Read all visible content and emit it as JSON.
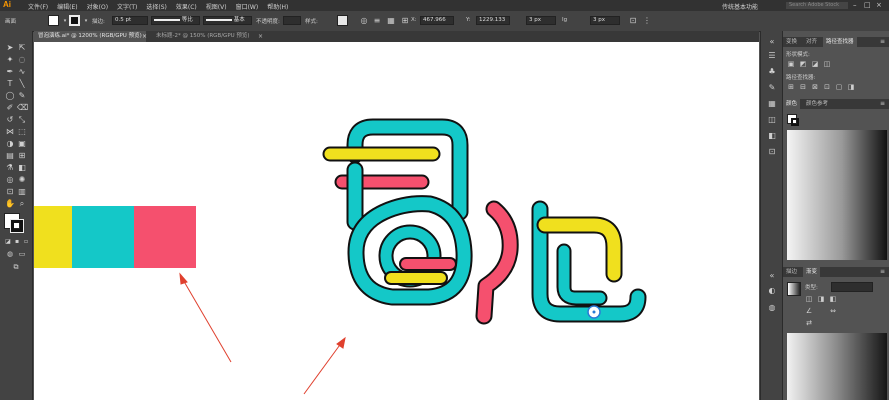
{
  "app": {
    "logo": "Ai"
  },
  "menu": [
    "文件(F)",
    "编辑(E)",
    "对象(O)",
    "文字(T)",
    "选择(S)",
    "效果(C)",
    "视图(V)",
    "窗口(W)",
    "帮助(H)"
  ],
  "workspace": "传统基本功能",
  "search_placeholder": "Search Adobe Stock",
  "control_bar": {
    "section_label": "画面",
    "stroke_label": "描边:",
    "stroke_weight": "0.5 pt",
    "profile_label": "等比",
    "brush_label": "基本",
    "opacity_label": "不透明度:",
    "style_label": "样式:",
    "x_label": "X:",
    "x_value": "467.966",
    "y_label": "Y:",
    "y_value": "1229.133",
    "w_value": "3 px",
    "h_label": "Ig",
    "h_value": "3 px"
  },
  "tabs": [
    {
      "label": "冒泡演练.ai* @ 1200% (RGB/GPU 预览)",
      "active": true
    },
    {
      "label": "未标题-2* @ 150% (RGB/GPU 预览)",
      "active": false
    }
  ],
  "panels": {
    "top_tabs": [
      "变换",
      "对齐",
      "路径查找器"
    ],
    "shape_modes_label": "形状模式:",
    "pathfinder_label": "路径查找器:",
    "color_tabs": [
      "颜色",
      "颜色参考"
    ],
    "bottom_tabs": [
      "描边",
      "渐变"
    ],
    "type_label": "类型:"
  },
  "colors": {
    "yellow": "#f0e01e",
    "teal": "#14c8c8",
    "pink": "#f5506e",
    "outline": "#111111",
    "arrow": "#e0402e",
    "accent": "#ff9a00"
  },
  "icons": {
    "canvas_swatches": [
      "yellow",
      "teal",
      "pink"
    ]
  }
}
